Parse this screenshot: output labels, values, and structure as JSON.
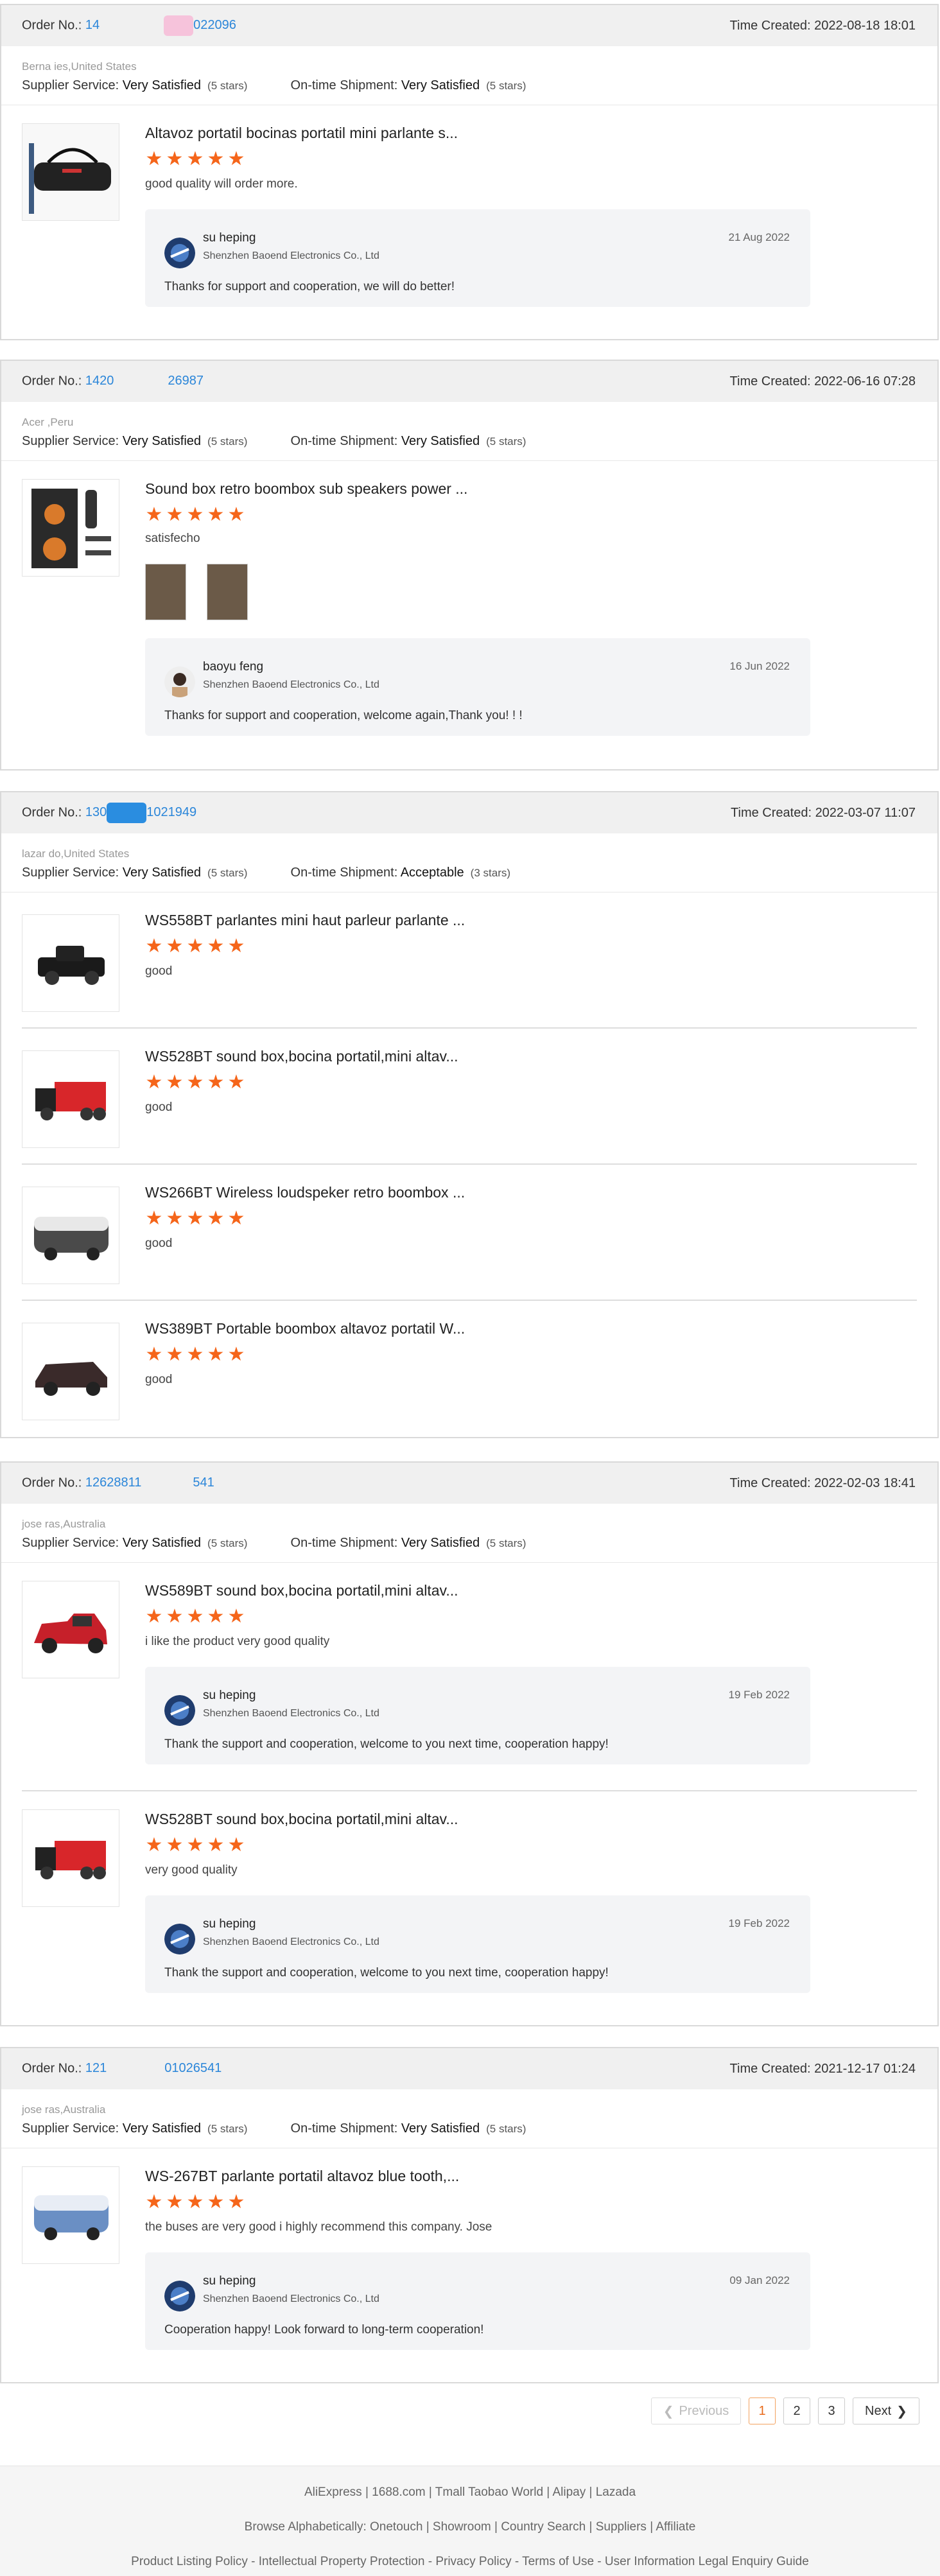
{
  "labels": {
    "order_no": "Order No.:",
    "time_created": "Time Created:",
    "supplier_service": "Supplier Service:",
    "ontime_shipment": "On-time Shipment:"
  },
  "orders": [
    {
      "num_a": "14",
      "num_b": "022096",
      "time": "2022-08-18 18:01",
      "buyer": "Berna         ies,United States",
      "supplier": "Very Satisfied",
      "supplier_count": "(5 stars)",
      "shipment": "Very Satisfied",
      "shipment_count": "(5 stars)",
      "items": [
        {
          "title": "Altavoz portatil bocinas portatil mini parlante s...",
          "comment": "good quality will order more.",
          "reply": {
            "name": "su heping",
            "company": "Shenzhen Baoend Electronics Co., Ltd",
            "date": "21 Aug 2022",
            "text": "Thanks for support and cooperation, we will do better!"
          }
        }
      ]
    },
    {
      "num_a": "1420",
      "num_b": "26987",
      "time": "2022-06-16 07:28",
      "buyer": "Acer      ,Peru",
      "supplier": "Very Satisfied",
      "supplier_count": "(5 stars)",
      "shipment": "Very Satisfied",
      "shipment_count": "(5 stars)",
      "items": [
        {
          "title": "Sound box retro boombox sub speakers power ...",
          "comment": "satisfecho",
          "reply": {
            "name": "baoyu feng",
            "company": "Shenzhen Baoend Electronics Co., Ltd",
            "date": "16 Jun 2022",
            "text": "Thanks for support and cooperation, welcome again,Thank you!  !  !"
          }
        }
      ]
    },
    {
      "num_a": "130",
      "num_b": "1021949",
      "time": "2022-03-07 11:07",
      "buyer": "lazar         do,United States",
      "supplier": "Very Satisfied",
      "supplier_count": "(5 stars)",
      "shipment": "Acceptable",
      "shipment_count": "(3 stars)",
      "items": [
        {
          "title": "WS558BT parlantes mini haut parleur parlante ...",
          "comment": "good"
        },
        {
          "title": "WS528BT sound box,bocina portatil,mini altav...",
          "comment": "good"
        },
        {
          "title": "WS266BT Wireless loudspeker retro boombox ...",
          "comment": "good"
        },
        {
          "title": "WS389BT Portable boombox altavoz portatil W...",
          "comment": "good"
        }
      ]
    },
    {
      "num_a": "12628811",
      "num_b": "541",
      "time": "2022-02-03 18:41",
      "buyer": "jose          ras,Australia",
      "supplier": "Very Satisfied",
      "supplier_count": "(5 stars)",
      "shipment": "Very Satisfied",
      "shipment_count": "(5 stars)",
      "items": [
        {
          "title": "WS589BT sound box,bocina portatil,mini altav...",
          "comment": "i like the product very good quality",
          "reply": {
            "name": "su heping",
            "company": "Shenzhen Baoend Electronics Co., Ltd",
            "date": "19 Feb 2022",
            "text": "Thank the support and cooperation, welcome to you next time, cooperation happy!"
          }
        },
        {
          "title": "WS528BT sound box,bocina portatil,mini altav...",
          "comment": "very good quality",
          "reply": {
            "name": "su heping",
            "company": "Shenzhen Baoend Electronics Co., Ltd",
            "date": "19 Feb 2022",
            "text": "Thank the support and cooperation, welcome to you next time, cooperation happy!"
          }
        }
      ]
    },
    {
      "num_a": "121",
      "num_b": "01026541",
      "time": "2021-12-17 01:24",
      "buyer": "jose         ras,Australia",
      "supplier": "Very Satisfied",
      "supplier_count": "(5 stars)",
      "shipment": "Very Satisfied",
      "shipment_count": "(5 stars)",
      "items": [
        {
          "title": "WS-267BT parlante portatil altavoz blue tooth,...",
          "comment": "the buses are very good i highly recommend this company. Jose",
          "reply": {
            "name": "su heping",
            "company": "Shenzhen Baoend Electronics Co., Ltd",
            "date": "09 Jan 2022",
            "text": "Cooperation happy! Look forward to long-term cooperation!"
          }
        }
      ]
    }
  ],
  "pagination": {
    "previous": "Previous",
    "pages": [
      "1",
      "2",
      "3"
    ],
    "current": "1",
    "next": "Next"
  },
  "footer": {
    "line1": "AliExpress | 1688.com | Tmall Taobao World | Alipay | Lazada",
    "line2": "Browse Alphabetically: Onetouch | Showroom | Country Search | Suppliers | Affiliate",
    "line3": "Product Listing Policy - Intellectual Property Protection - Privacy Policy - Terms of Use - User Information Legal Enquiry Guide"
  },
  "colors": {
    "link": "#2b86d9",
    "star": "#f5651a",
    "active_page": "#e86a1a"
  },
  "icons": {
    "star": "star-icon",
    "prev": "chevron-left-icon",
    "next": "chevron-right-icon"
  }
}
